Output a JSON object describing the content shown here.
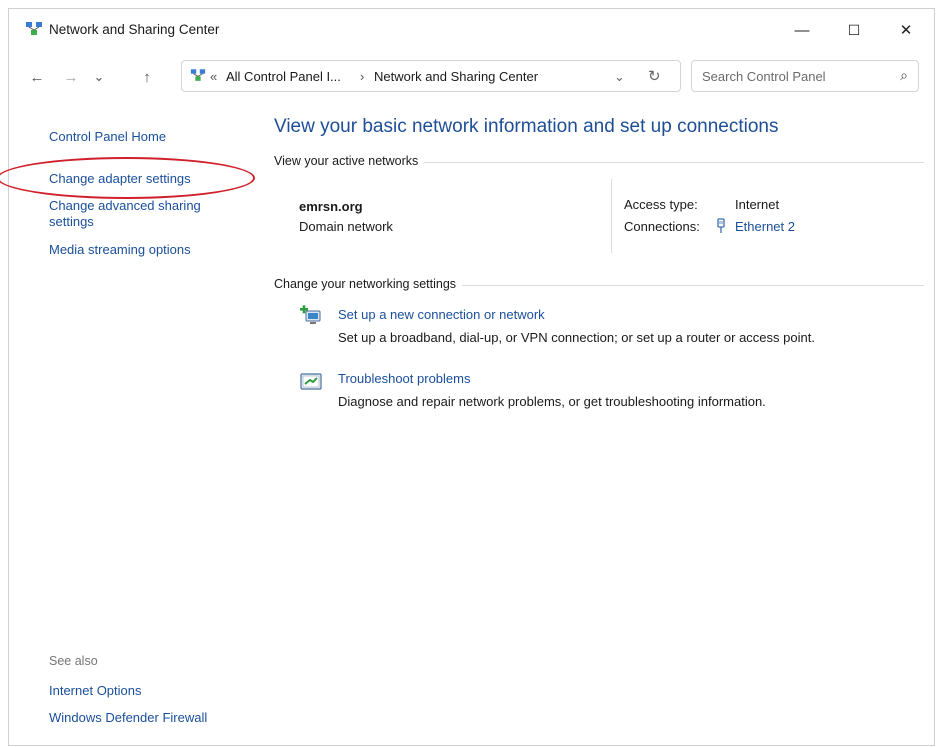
{
  "window": {
    "title": "Network and Sharing Center",
    "controls": {
      "minimize": "—",
      "maximize": "☐",
      "close": "✕"
    }
  },
  "nav": {
    "back": "←",
    "forward": "→",
    "recent": "⌄",
    "up": "↑",
    "breadcrumb": {
      "overflow": "«",
      "parent": "All Control Panel I...",
      "separator": "›",
      "current": "Network and Sharing Center"
    },
    "dropdown": "⌄",
    "refresh": "↻",
    "search_placeholder": "Search Control Panel",
    "search_icon": "⌕"
  },
  "sidebar": {
    "items": [
      {
        "label": "Control Panel Home"
      },
      {
        "label": "Change adapter settings"
      },
      {
        "label": "Change advanced sharing settings"
      },
      {
        "label": "Media streaming options"
      }
    ],
    "see_also_label": "See also",
    "see_also": [
      {
        "label": "Internet Options"
      },
      {
        "label": "Windows Defender Firewall"
      }
    ]
  },
  "main": {
    "heading": "View your basic network information and set up connections",
    "active_networks_label": "View your active networks",
    "network": {
      "name": "emrsn.org",
      "type": "Domain network",
      "access_type_label": "Access type:",
      "access_type_value": "Internet",
      "connections_label": "Connections:",
      "connections_value": "Ethernet 2"
    },
    "change_settings_label": "Change your networking settings",
    "tasks": [
      {
        "title": "Set up a new connection or network",
        "desc": "Set up a broadband, dial-up, or VPN connection; or set up a router or access point.",
        "icon": "new-connection-icon"
      },
      {
        "title": "Troubleshoot problems",
        "desc": "Diagnose and repair network problems, or get troubleshooting information.",
        "icon": "troubleshoot-icon"
      }
    ]
  },
  "colors": {
    "link": "#1a4f9c",
    "heading": "#1e4e96",
    "annotation": "#d0202b"
  }
}
